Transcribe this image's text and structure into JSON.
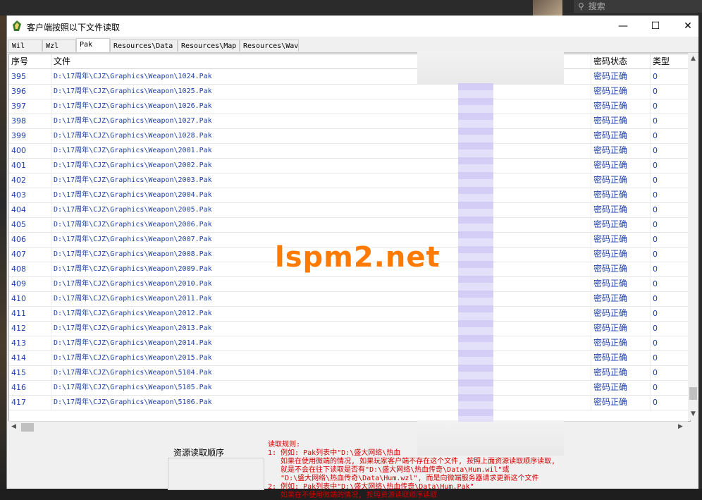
{
  "desktop": {
    "search_placeholder": "搜索",
    "search_icon": "search-icon"
  },
  "window": {
    "title": "客户端按照以下文件读取",
    "minimize": "—",
    "maximize": "☐",
    "close": "✕"
  },
  "tabs": [
    {
      "label": "Wil",
      "active": false
    },
    {
      "label": "Wzl",
      "active": false
    },
    {
      "label": "Pak",
      "active": true
    },
    {
      "label": "Resources\\Data",
      "active": false
    },
    {
      "label": "Resources\\Map",
      "active": false
    },
    {
      "label": "Resources\\Wav",
      "active": false
    }
  ],
  "columns": {
    "index": "序号",
    "file": "文件",
    "status": "密码状态",
    "type": "类型"
  },
  "rows": [
    {
      "index": "395",
      "file": "D:\\17周年\\CJZ\\Graphics\\Weapon\\1024.Pak",
      "status": "密码正确",
      "type": "0"
    },
    {
      "index": "396",
      "file": "D:\\17周年\\CJZ\\Graphics\\Weapon\\1025.Pak",
      "status": "密码正确",
      "type": "0"
    },
    {
      "index": "397",
      "file": "D:\\17周年\\CJZ\\Graphics\\Weapon\\1026.Pak",
      "status": "密码正确",
      "type": "0"
    },
    {
      "index": "398",
      "file": "D:\\17周年\\CJZ\\Graphics\\Weapon\\1027.Pak",
      "status": "密码正确",
      "type": "0"
    },
    {
      "index": "399",
      "file": "D:\\17周年\\CJZ\\Graphics\\Weapon\\1028.Pak",
      "status": "密码正确",
      "type": "0"
    },
    {
      "index": "400",
      "file": "D:\\17周年\\CJZ\\Graphics\\Weapon\\2001.Pak",
      "status": "密码正确",
      "type": "0"
    },
    {
      "index": "401",
      "file": "D:\\17周年\\CJZ\\Graphics\\Weapon\\2002.Pak",
      "status": "密码正确",
      "type": "0"
    },
    {
      "index": "402",
      "file": "D:\\17周年\\CJZ\\Graphics\\Weapon\\2003.Pak",
      "status": "密码正确",
      "type": "0"
    },
    {
      "index": "403",
      "file": "D:\\17周年\\CJZ\\Graphics\\Weapon\\2004.Pak",
      "status": "密码正确",
      "type": "0"
    },
    {
      "index": "404",
      "file": "D:\\17周年\\CJZ\\Graphics\\Weapon\\2005.Pak",
      "status": "密码正确",
      "type": "0"
    },
    {
      "index": "405",
      "file": "D:\\17周年\\CJZ\\Graphics\\Weapon\\2006.Pak",
      "status": "密码正确",
      "type": "0"
    },
    {
      "index": "406",
      "file": "D:\\17周年\\CJZ\\Graphics\\Weapon\\2007.Pak",
      "status": "密码正确",
      "type": "0"
    },
    {
      "index": "407",
      "file": "D:\\17周年\\CJZ\\Graphics\\Weapon\\2008.Pak",
      "status": "密码正确",
      "type": "0"
    },
    {
      "index": "408",
      "file": "D:\\17周年\\CJZ\\Graphics\\Weapon\\2009.Pak",
      "status": "密码正确",
      "type": "0"
    },
    {
      "index": "409",
      "file": "D:\\17周年\\CJZ\\Graphics\\Weapon\\2010.Pak",
      "status": "密码正确",
      "type": "0"
    },
    {
      "index": "410",
      "file": "D:\\17周年\\CJZ\\Graphics\\Weapon\\2011.Pak",
      "status": "密码正确",
      "type": "0"
    },
    {
      "index": "411",
      "file": "D:\\17周年\\CJZ\\Graphics\\Weapon\\2012.Pak",
      "status": "密码正确",
      "type": "0"
    },
    {
      "index": "412",
      "file": "D:\\17周年\\CJZ\\Graphics\\Weapon\\2013.Pak",
      "status": "密码正确",
      "type": "0"
    },
    {
      "index": "413",
      "file": "D:\\17周年\\CJZ\\Graphics\\Weapon\\2014.Pak",
      "status": "密码正确",
      "type": "0"
    },
    {
      "index": "414",
      "file": "D:\\17周年\\CJZ\\Graphics\\Weapon\\2015.Pak",
      "status": "密码正确",
      "type": "0"
    },
    {
      "index": "415",
      "file": "D:\\17周年\\CJZ\\Graphics\\Weapon\\5104.Pak",
      "status": "密码正确",
      "type": "0"
    },
    {
      "index": "416",
      "file": "D:\\17周年\\CJZ\\Graphics\\Weapon\\5105.Pak",
      "status": "密码正确",
      "type": "0"
    },
    {
      "index": "417",
      "file": "D:\\17周年\\CJZ\\Graphics\\Weapon\\5106.Pak",
      "status": "密码正确",
      "type": "0"
    }
  ],
  "bottom": {
    "order_label": "资源读取顺序",
    "rules_text": "读取规则:\n1: 例如: Pak列表中\"D:\\盛大网络\\热血\n   如果在使用微端的情况, 如果玩家客户端不存在这个文件, 按照上面资源读取顺序读取,\n   就是不会在往下读取是否有\"D:\\盛大网络\\热血传奇\\Data\\Hum.wil\"或\n   \"D:\\盛大网络\\热血传奇\\Data\\Hum.wzl\", 而是向微端服务器请求更新这个文件\n2: 例如: Pak列表中\"D:\\盛大网络\\热血传奇\\Data\\Hum.Pak\"\n   如果在不使用微端的情况, 按照资源读取顺序读取"
  },
  "watermark": "lspm2.net",
  "colors": {
    "link_text": "#1d3ea8",
    "rules_text": "#d40000",
    "watermark": "#ff7a00"
  }
}
